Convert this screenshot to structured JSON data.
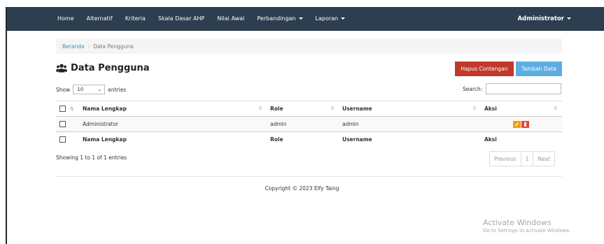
{
  "navbar": {
    "items": [
      {
        "label": "Home",
        "dropdown": false
      },
      {
        "label": "Alternatif",
        "dropdown": false
      },
      {
        "label": "Kriteria",
        "dropdown": false
      },
      {
        "label": "Skala Dasar AHP",
        "dropdown": false
      },
      {
        "label": "Nilai Awal",
        "dropdown": false
      },
      {
        "label": "Perbandingan",
        "dropdown": true
      },
      {
        "label": "Laporan",
        "dropdown": true
      }
    ],
    "user": "Administrator"
  },
  "breadcrumb": {
    "home": "Beranda",
    "separator": "/",
    "current": "Data Pengguna"
  },
  "page": {
    "title": "Data Pengguna",
    "title_icon": "users-icon"
  },
  "buttons": {
    "hapus": "Hapus Contengan",
    "tambah": "Tambah Data"
  },
  "table_controls": {
    "show_label": "Show",
    "entries_value": "10",
    "entries_label": "entries",
    "search_label": "Search:",
    "search_value": ""
  },
  "table": {
    "columns": [
      "Nama Lengkap",
      "Role",
      "Username",
      "Aksi"
    ],
    "rows": [
      {
        "nama": "Administrator",
        "role": "admin",
        "username": "admin"
      }
    ]
  },
  "info": "Showing 1 to 1 of 1 entries",
  "pagination": {
    "previous": "Previous",
    "page": "1",
    "next": "Next"
  },
  "footer": {
    "copyright": "Copyright © 2023 Elfy Taing"
  },
  "watermark": {
    "title": "Activate Windows",
    "subtitle": "Go to Settings to activate Windows."
  },
  "colors": {
    "navbar": "#2c3e50",
    "danger": "#c0392b",
    "info": "#5dade2",
    "edit": "#f39c12",
    "delete": "#dd4b39"
  }
}
